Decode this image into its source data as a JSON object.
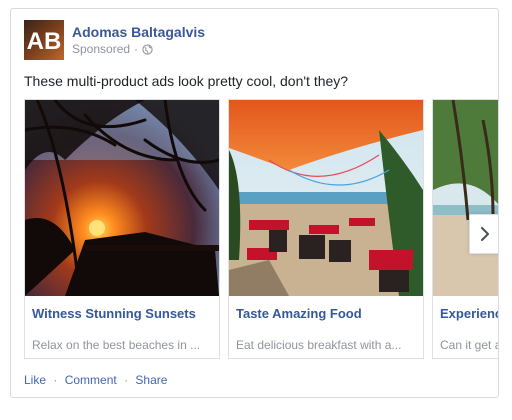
{
  "post": {
    "author": "Adomas Baltagalvis",
    "avatar_initials": "AB",
    "sponsored_label": "Sponsored",
    "meta_separator": "·",
    "message": "These multi-product ads look pretty cool, don't they?"
  },
  "carousel": {
    "items": [
      {
        "title": "Witness Stunning Sunsets",
        "description": "Relax on the best beaches in ..."
      },
      {
        "title": "Taste Amazing Food",
        "description": "Eat delicious breakfast with a..."
      },
      {
        "title": "Experience",
        "description": "Can it get a"
      }
    ],
    "next_icon": "chevron-right-icon"
  },
  "actions": {
    "like": "Like",
    "comment": "Comment",
    "share": "Share",
    "separator": "·"
  },
  "colors": {
    "link_blue": "#365899",
    "name_blue": "#3b5998",
    "action_blue": "#4267b2",
    "muted_gray": "#90949c",
    "border": "#dddfe2",
    "text": "#1d2129"
  }
}
